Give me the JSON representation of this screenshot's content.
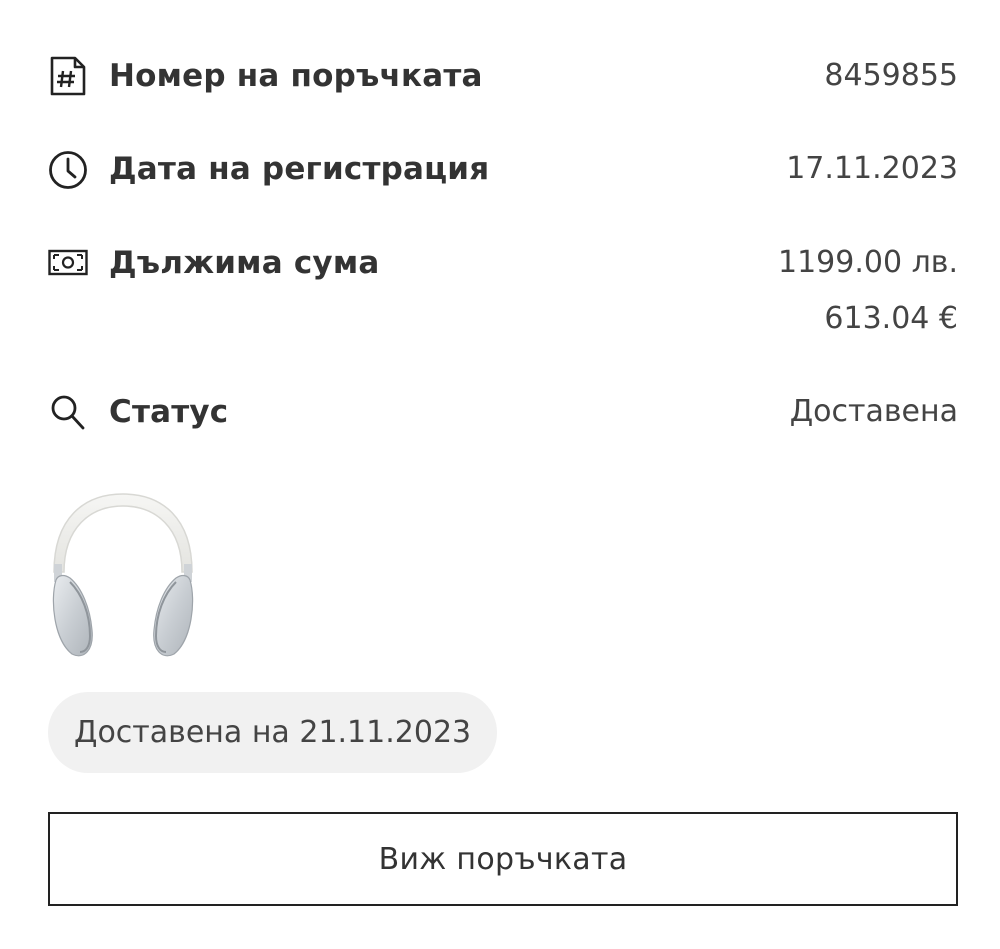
{
  "order_details": {
    "order_number": {
      "icon": "document-hash-icon",
      "label": "Номер на поръчката",
      "value": "8459855"
    },
    "registration_date": {
      "icon": "clock-icon",
      "label": "Дата на регистрация",
      "value": "17.11.2023"
    },
    "amount_due": {
      "icon": "banknote-icon",
      "label": "Дължима сума",
      "value_bgn": "1199.00 лв.",
      "value_eur": "613.04 €"
    },
    "status": {
      "icon": "magnifier-icon",
      "label": "Статус",
      "value": "Доставена"
    }
  },
  "product": {
    "image": "headphones-image"
  },
  "delivery": {
    "chip_text": "Доставена на 21.11.2023"
  },
  "actions": {
    "view_order_label": "Виж поръчката"
  }
}
